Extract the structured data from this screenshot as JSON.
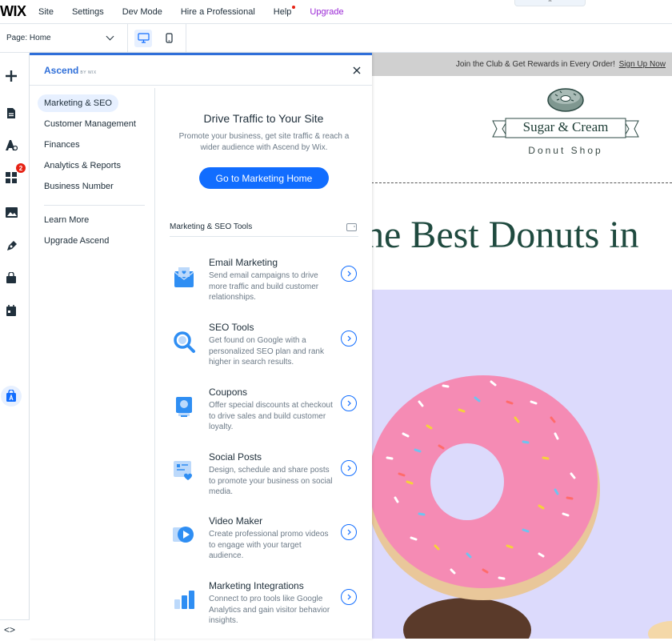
{
  "topbar": {
    "logo": "WIX",
    "menu": [
      "Site",
      "Settings",
      "Dev Mode",
      "Hire a Professional",
      "Help",
      "Upgrade"
    ],
    "pill_glyph": "^"
  },
  "subbar": {
    "page_label": "Page:",
    "page_value": "Home"
  },
  "leftbar": {
    "apps_badge": "2",
    "items": [
      "add-icon",
      "pages-icon",
      "design-icon",
      "apps-icon",
      "media-icon",
      "blog-icon",
      "store-icon",
      "bookings-icon",
      "ascend-icon"
    ],
    "bottom": "<>"
  },
  "panel": {
    "logo": "Ascend",
    "logo_sub": "BY WIX",
    "nav": [
      "Marketing & SEO",
      "Customer Management",
      "Finances",
      "Analytics & Reports",
      "Business Number",
      "Learn More",
      "Upgrade Ascend"
    ],
    "main": {
      "title": "Drive Traffic to Your Site",
      "description": "Promote your business, get site traffic & reach a wider audience with Ascend by Wix.",
      "button": "Go to Marketing Home",
      "tools_header": "Marketing & SEO Tools",
      "tools": [
        {
          "title": "Email Marketing",
          "desc": "Send email campaigns to drive more traffic and build customer relationships.",
          "icon": "email-icon"
        },
        {
          "title": "SEO Tools",
          "desc": "Get found on Google with a personalized SEO plan and rank higher in search results.",
          "icon": "seo-icon"
        },
        {
          "title": "Coupons",
          "desc": "Offer special discounts at checkout to drive sales and build customer loyalty.",
          "icon": "coupon-icon"
        },
        {
          "title": "Social Posts",
          "desc": "Design, schedule and share posts to promote your business on social media.",
          "icon": "social-icon"
        },
        {
          "title": "Video Maker",
          "desc": "Create professional promo videos to engage with your target audience.",
          "icon": "video-icon"
        },
        {
          "title": "Marketing Integrations",
          "desc": "Connect to pro tools like Google Analytics and gain visitor behavior insights.",
          "icon": "integrations-icon"
        }
      ]
    }
  },
  "site": {
    "promo_text": "Join the Club & Get Rewards in Every Order!",
    "promo_link": "Sign Up Now",
    "brand_name": "Sugar & Cream",
    "brand_sub": "Donut Shop",
    "hero_title": "he Best Donuts in",
    "colors": {
      "accent": "#116dff",
      "hero_bg": "#dcdafc",
      "donut": "#f58bb4",
      "brand": "#1f4a3f"
    }
  }
}
